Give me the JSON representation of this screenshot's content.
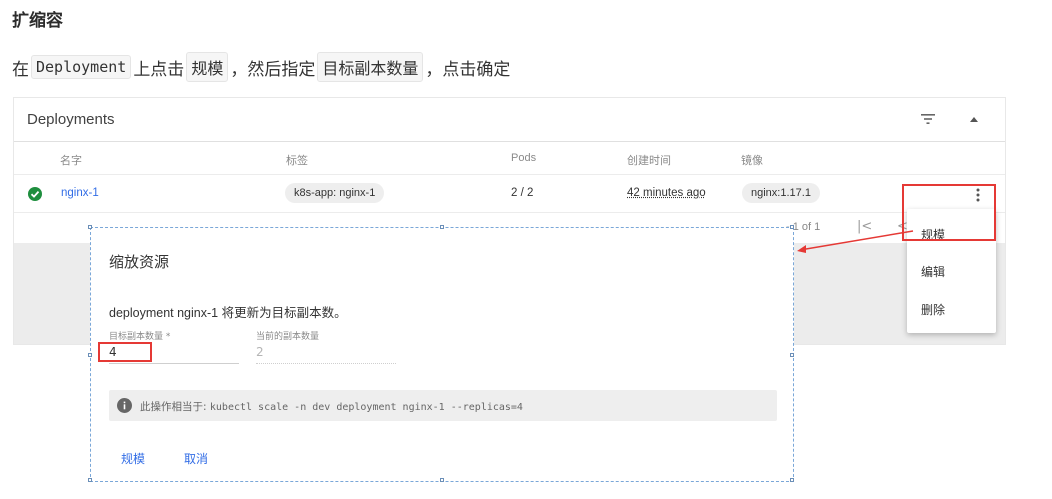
{
  "doc": {
    "heading": "扩缩容",
    "line_pre": "在",
    "code_deployment": "Deployment",
    "line_mid1": "上点击",
    "code_scale": "规模",
    "line_mid2": "，然后指定",
    "code_target": "目标副本数量",
    "line_end": "，点击确定"
  },
  "card": {
    "title": "Deployments",
    "columns": [
      "名字",
      "标签",
      "Pods",
      "创建时间",
      "镜像"
    ],
    "row": {
      "name": "nginx-1",
      "label": "k8s-app: nginx-1",
      "pods": "2 / 2",
      "created": "42 minutes ago",
      "image": "nginx:1.17.1"
    },
    "pager": "- 1 of 1"
  },
  "menu": {
    "items": [
      "规模",
      "编辑",
      "删除"
    ]
  },
  "dialog": {
    "title": "缩放资源",
    "description": "deployment nginx-1 将更新为目标副本数。",
    "target_label": "目标副本数量 *",
    "target_value": "4",
    "current_label": "当前的副本数量",
    "current_value": "2",
    "hint_prefix": "此操作相当于:",
    "hint_command": "kubectl scale -n dev deployment nginx-1 --replicas=4",
    "confirm_label": "规模",
    "cancel_label": "取消"
  },
  "colors": {
    "accent": "#326de6",
    "annotation": "#e53935",
    "status_ok": "#1e8e3e"
  },
  "icons": [
    "filter-icon",
    "chevron-up-icon",
    "check-circle-icon",
    "more-vert-icon",
    "first-page-icon",
    "prev-page-icon",
    "info-icon"
  ]
}
